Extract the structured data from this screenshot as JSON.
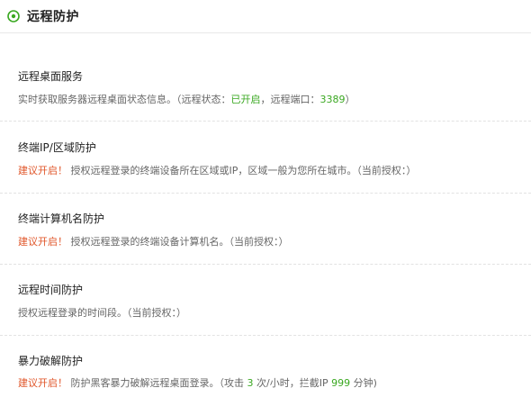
{
  "header": {
    "title": "远程防护"
  },
  "sections": [
    {
      "title": "远程桌面服务",
      "desc_prefix": "实时获取服务器远程桌面状态信息。（远程状态：",
      "status_value": "已开启",
      "desc_mid": "，远程端口：",
      "port_value": "3389",
      "desc_suffix": "）"
    },
    {
      "title": "终端IP/区域防护",
      "warn": "建议开启！",
      "desc": "授权远程登录的终端设备所在区域或IP，区域一般为您所在城市。（当前授权：）"
    },
    {
      "title": "终端计算机名防护",
      "warn": "建议开启！",
      "desc": "授权远程登录的终端设备计算机名。（当前授权：）"
    },
    {
      "title": "远程时间防护",
      "desc": "授权远程登录的时间段。（当前授权：）"
    },
    {
      "title": "暴力破解防护",
      "warn": "建议开启！",
      "desc_prefix": "防护黑客暴力破解远程桌面登录。（攻击",
      "attempts": "3",
      "desc_mid": "次/小时，拦截IP",
      "block_minutes": "999",
      "desc_suffix": "分钟)"
    }
  ],
  "colors": {
    "warn": "#e0562a",
    "accent": "#3aa821"
  }
}
